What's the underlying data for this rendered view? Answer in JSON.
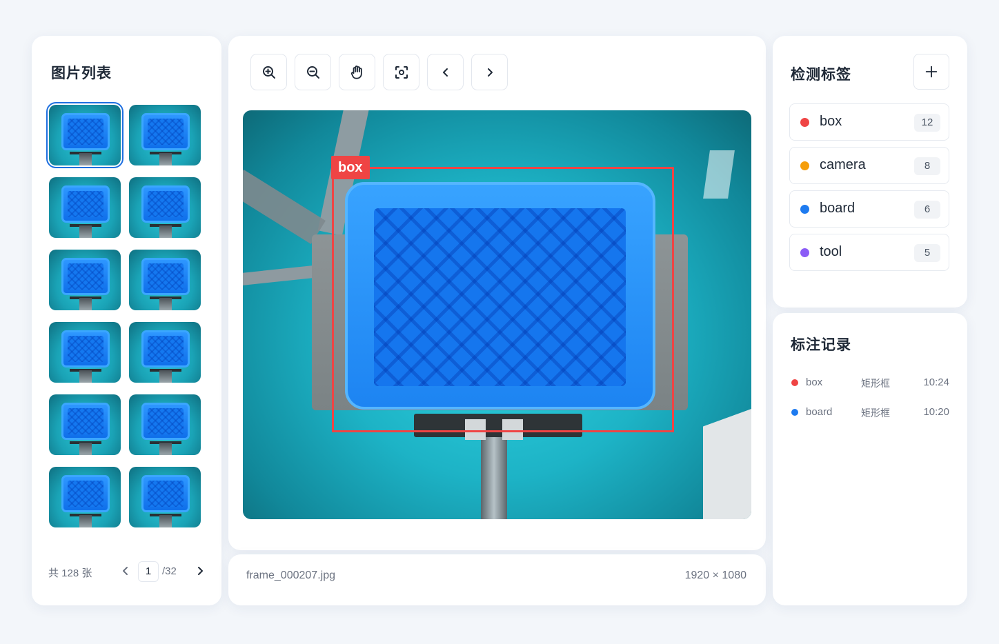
{
  "image_list": {
    "title": "图片列表",
    "thumbnail_count": 12,
    "selected_index": 0,
    "pager": {
      "total_text": "共 128 张",
      "current_page": "1",
      "total_pages_text": "/32"
    }
  },
  "toolbar": {
    "buttons": [
      {
        "icon": "zoom-in-icon"
      },
      {
        "icon": "zoom-out-icon"
      },
      {
        "icon": "hand-pan-icon"
      },
      {
        "icon": "fit-screen-icon"
      },
      {
        "icon": "chevron-left-icon"
      },
      {
        "icon": "chevron-right-icon"
      }
    ]
  },
  "viewer": {
    "annotation": {
      "label": "box",
      "color": "#ef4444"
    }
  },
  "file_info": {
    "filename": "frame_000207.jpg",
    "dimensions": "1920 × 1080"
  },
  "labels_panel": {
    "title": "检测标签",
    "add_icon": "plus-icon",
    "items": [
      {
        "name": "box",
        "count": "12",
        "color": "#ef4444"
      },
      {
        "name": "camera",
        "count": "8",
        "color": "#f59e0b"
      },
      {
        "name": "board",
        "count": "6",
        "color": "#1e7bf0"
      },
      {
        "name": "tool",
        "count": "5",
        "color": "#8b5cf6"
      }
    ]
  },
  "records_panel": {
    "title": "标注记录",
    "rows": [
      {
        "label": "box",
        "type": "矩形框",
        "time": "10:24",
        "color": "#ef4444"
      },
      {
        "label": "board",
        "type": "矩形框",
        "time": "10:20",
        "color": "#1e7bf0"
      }
    ]
  }
}
